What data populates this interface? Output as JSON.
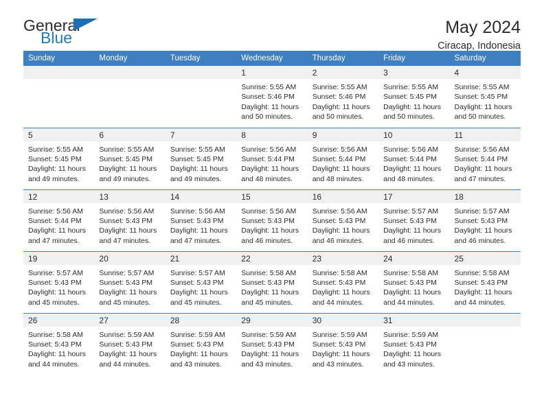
{
  "logo": {
    "word_top": "General",
    "word_bottom": "Blue",
    "accent_color": "#1c6fb5",
    "triangle_icon": "triangle-icon"
  },
  "header": {
    "title": "May 2024",
    "subtitle": "Ciracap, Indonesia",
    "header_bg": "#3d7fc1",
    "header_text_color": "#ffffff"
  },
  "weekdays": [
    "Sunday",
    "Monday",
    "Tuesday",
    "Wednesday",
    "Thursday",
    "Friday",
    "Saturday"
  ],
  "weeks": [
    [
      {
        "day": "",
        "sunrise": "",
        "sunset": "",
        "daylight1": "",
        "daylight2": ""
      },
      {
        "day": "",
        "sunrise": "",
        "sunset": "",
        "daylight1": "",
        "daylight2": ""
      },
      {
        "day": "",
        "sunrise": "",
        "sunset": "",
        "daylight1": "",
        "daylight2": ""
      },
      {
        "day": "1",
        "sunrise": "Sunrise: 5:55 AM",
        "sunset": "Sunset: 5:46 PM",
        "daylight1": "Daylight: 11 hours",
        "daylight2": "and 50 minutes."
      },
      {
        "day": "2",
        "sunrise": "Sunrise: 5:55 AM",
        "sunset": "Sunset: 5:46 PM",
        "daylight1": "Daylight: 11 hours",
        "daylight2": "and 50 minutes."
      },
      {
        "day": "3",
        "sunrise": "Sunrise: 5:55 AM",
        "sunset": "Sunset: 5:45 PM",
        "daylight1": "Daylight: 11 hours",
        "daylight2": "and 50 minutes."
      },
      {
        "day": "4",
        "sunrise": "Sunrise: 5:55 AM",
        "sunset": "Sunset: 5:45 PM",
        "daylight1": "Daylight: 11 hours",
        "daylight2": "and 50 minutes."
      }
    ],
    [
      {
        "day": "5",
        "sunrise": "Sunrise: 5:55 AM",
        "sunset": "Sunset: 5:45 PM",
        "daylight1": "Daylight: 11 hours",
        "daylight2": "and 49 minutes."
      },
      {
        "day": "6",
        "sunrise": "Sunrise: 5:55 AM",
        "sunset": "Sunset: 5:45 PM",
        "daylight1": "Daylight: 11 hours",
        "daylight2": "and 49 minutes."
      },
      {
        "day": "7",
        "sunrise": "Sunrise: 5:55 AM",
        "sunset": "Sunset: 5:45 PM",
        "daylight1": "Daylight: 11 hours",
        "daylight2": "and 49 minutes."
      },
      {
        "day": "8",
        "sunrise": "Sunrise: 5:56 AM",
        "sunset": "Sunset: 5:44 PM",
        "daylight1": "Daylight: 11 hours",
        "daylight2": "and 48 minutes."
      },
      {
        "day": "9",
        "sunrise": "Sunrise: 5:56 AM",
        "sunset": "Sunset: 5:44 PM",
        "daylight1": "Daylight: 11 hours",
        "daylight2": "and 48 minutes."
      },
      {
        "day": "10",
        "sunrise": "Sunrise: 5:56 AM",
        "sunset": "Sunset: 5:44 PM",
        "daylight1": "Daylight: 11 hours",
        "daylight2": "and 48 minutes."
      },
      {
        "day": "11",
        "sunrise": "Sunrise: 5:56 AM",
        "sunset": "Sunset: 5:44 PM",
        "daylight1": "Daylight: 11 hours",
        "daylight2": "and 47 minutes."
      }
    ],
    [
      {
        "day": "12",
        "sunrise": "Sunrise: 5:56 AM",
        "sunset": "Sunset: 5:44 PM",
        "daylight1": "Daylight: 11 hours",
        "daylight2": "and 47 minutes."
      },
      {
        "day": "13",
        "sunrise": "Sunrise: 5:56 AM",
        "sunset": "Sunset: 5:43 PM",
        "daylight1": "Daylight: 11 hours",
        "daylight2": "and 47 minutes."
      },
      {
        "day": "14",
        "sunrise": "Sunrise: 5:56 AM",
        "sunset": "Sunset: 5:43 PM",
        "daylight1": "Daylight: 11 hours",
        "daylight2": "and 47 minutes."
      },
      {
        "day": "15",
        "sunrise": "Sunrise: 5:56 AM",
        "sunset": "Sunset: 5:43 PM",
        "daylight1": "Daylight: 11 hours",
        "daylight2": "and 46 minutes."
      },
      {
        "day": "16",
        "sunrise": "Sunrise: 5:56 AM",
        "sunset": "Sunset: 5:43 PM",
        "daylight1": "Daylight: 11 hours",
        "daylight2": "and 46 minutes."
      },
      {
        "day": "17",
        "sunrise": "Sunrise: 5:57 AM",
        "sunset": "Sunset: 5:43 PM",
        "daylight1": "Daylight: 11 hours",
        "daylight2": "and 46 minutes."
      },
      {
        "day": "18",
        "sunrise": "Sunrise: 5:57 AM",
        "sunset": "Sunset: 5:43 PM",
        "daylight1": "Daylight: 11 hours",
        "daylight2": "and 46 minutes."
      }
    ],
    [
      {
        "day": "19",
        "sunrise": "Sunrise: 5:57 AM",
        "sunset": "Sunset: 5:43 PM",
        "daylight1": "Daylight: 11 hours",
        "daylight2": "and 45 minutes."
      },
      {
        "day": "20",
        "sunrise": "Sunrise: 5:57 AM",
        "sunset": "Sunset: 5:43 PM",
        "daylight1": "Daylight: 11 hours",
        "daylight2": "and 45 minutes."
      },
      {
        "day": "21",
        "sunrise": "Sunrise: 5:57 AM",
        "sunset": "Sunset: 5:43 PM",
        "daylight1": "Daylight: 11 hours",
        "daylight2": "and 45 minutes."
      },
      {
        "day": "22",
        "sunrise": "Sunrise: 5:58 AM",
        "sunset": "Sunset: 5:43 PM",
        "daylight1": "Daylight: 11 hours",
        "daylight2": "and 45 minutes."
      },
      {
        "day": "23",
        "sunrise": "Sunrise: 5:58 AM",
        "sunset": "Sunset: 5:43 PM",
        "daylight1": "Daylight: 11 hours",
        "daylight2": "and 44 minutes."
      },
      {
        "day": "24",
        "sunrise": "Sunrise: 5:58 AM",
        "sunset": "Sunset: 5:43 PM",
        "daylight1": "Daylight: 11 hours",
        "daylight2": "and 44 minutes."
      },
      {
        "day": "25",
        "sunrise": "Sunrise: 5:58 AM",
        "sunset": "Sunset: 5:43 PM",
        "daylight1": "Daylight: 11 hours",
        "daylight2": "and 44 minutes."
      }
    ],
    [
      {
        "day": "26",
        "sunrise": "Sunrise: 5:58 AM",
        "sunset": "Sunset: 5:43 PM",
        "daylight1": "Daylight: 11 hours",
        "daylight2": "and 44 minutes."
      },
      {
        "day": "27",
        "sunrise": "Sunrise: 5:59 AM",
        "sunset": "Sunset: 5:43 PM",
        "daylight1": "Daylight: 11 hours",
        "daylight2": "and 44 minutes."
      },
      {
        "day": "28",
        "sunrise": "Sunrise: 5:59 AM",
        "sunset": "Sunset: 5:43 PM",
        "daylight1": "Daylight: 11 hours",
        "daylight2": "and 43 minutes."
      },
      {
        "day": "29",
        "sunrise": "Sunrise: 5:59 AM",
        "sunset": "Sunset: 5:43 PM",
        "daylight1": "Daylight: 11 hours",
        "daylight2": "and 43 minutes."
      },
      {
        "day": "30",
        "sunrise": "Sunrise: 5:59 AM",
        "sunset": "Sunset: 5:43 PM",
        "daylight1": "Daylight: 11 hours",
        "daylight2": "and 43 minutes."
      },
      {
        "day": "31",
        "sunrise": "Sunrise: 5:59 AM",
        "sunset": "Sunset: 5:43 PM",
        "daylight1": "Daylight: 11 hours",
        "daylight2": "and 43 minutes."
      },
      {
        "day": "",
        "sunrise": "",
        "sunset": "",
        "daylight1": "",
        "daylight2": ""
      }
    ]
  ]
}
